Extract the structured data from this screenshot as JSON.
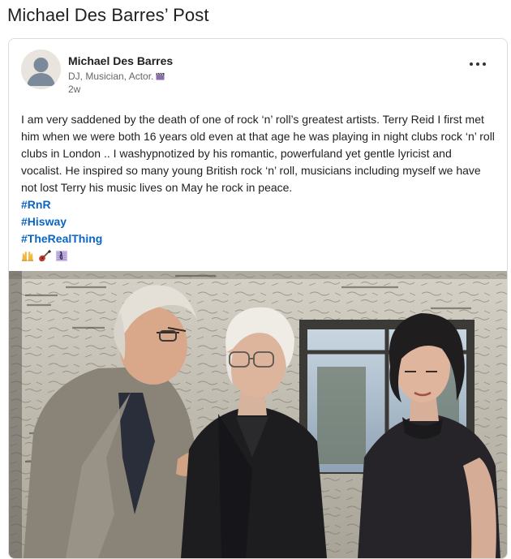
{
  "page": {
    "title": "Michael Des Barres’ Post"
  },
  "post": {
    "author": {
      "name": "Michael Des Barres",
      "headline": "DJ, Musician, Actor.",
      "headline_icon": "clapper-board-icon",
      "time": "2w"
    },
    "menu_icon": "more-horizontal-icon",
    "text": "I am very saddened by the death of one of rock ‘n’ roll’s greatest artists. Terry Reid I first met him when we were both 16 years old even at that age he was playing in night clubs rock ‘n’ roll clubs in London .. I washypnotized by his romantic, powerfuland yet gentle lyricist and vocalist. He inspired so many young British rock ‘n’ roll, musicians including myself we have not lost Terry his music lives on May he rock in peace.",
    "hashtags": [
      "#RnR",
      "#Hisway",
      "#TheRealThing"
    ],
    "emojis": [
      "raising-hands-icon",
      "guitar-icon",
      "musical-score-icon"
    ],
    "image": {
      "kind": "photo",
      "subject": "three-people-in-graffiti-room"
    }
  },
  "colors": {
    "link": "#0a66c2",
    "text": "#1f1f1f",
    "muted": "#666666",
    "border": "#dedcd8"
  }
}
